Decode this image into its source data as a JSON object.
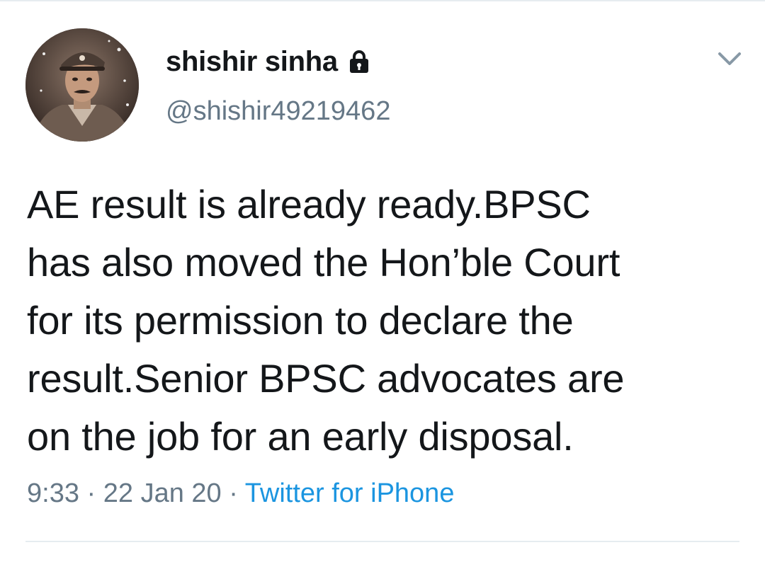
{
  "tweet": {
    "author": {
      "display_name": "shishir sinha",
      "handle": "@shishir49219462",
      "protected_icon": "lock-icon",
      "avatar": "avatar"
    },
    "menu_icon": "chevron-down-icon",
    "text_lines": [
      "AE result is already ready.BPSC",
      "has also moved the Hon’ble Court",
      "for its permission to declare the",
      "result.Senior BPSC advocates are",
      "on the job for an early disposal."
    ],
    "time": "9:33",
    "separator": "·",
    "date": "22 Jan 20",
    "source": "Twitter for iPhone"
  },
  "colors": {
    "text": "#14171a",
    "secondary": "#657786",
    "link": "#1b95e0",
    "divider": "#e6ecf0"
  }
}
